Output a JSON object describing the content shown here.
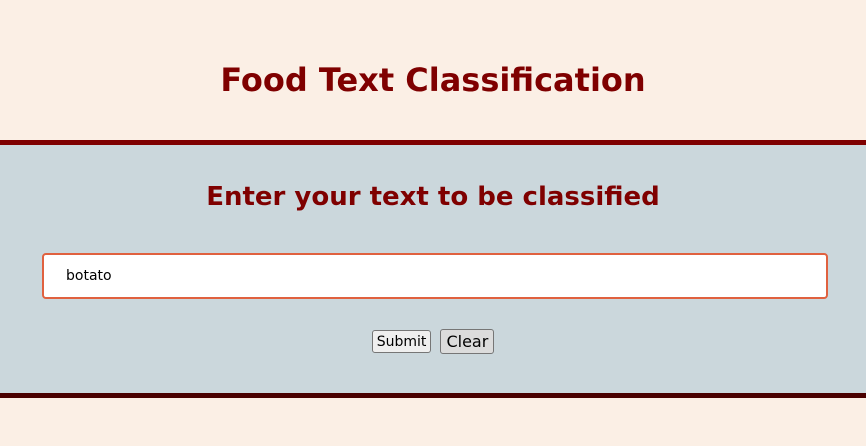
{
  "header": {
    "title": "Food Text Classification"
  },
  "form": {
    "heading": "Enter your text to be classified",
    "input_value": "botato",
    "submit_label": "Submit",
    "clear_label": "Clear"
  },
  "colors": {
    "background": "#fbefe5",
    "panel": "#cbd7dc",
    "accent": "#7f0000",
    "input_border": "#e0613f"
  }
}
